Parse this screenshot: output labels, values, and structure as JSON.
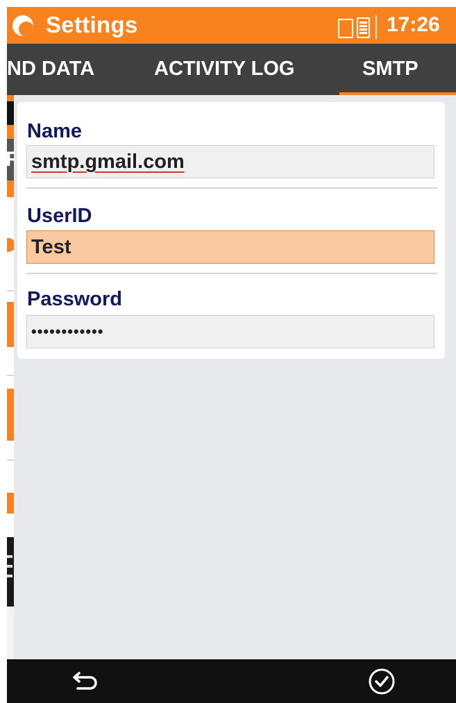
{
  "status_bar": {
    "title": "Settings",
    "time": "17:26",
    "icons": [
      "app-logo-icon",
      "phone-icon",
      "battery-icon"
    ]
  },
  "tabs": [
    {
      "label": "ND DATA",
      "selected": false
    },
    {
      "label": "ACTIVITY LOG",
      "selected": false
    },
    {
      "label": "SMTP",
      "selected": true
    }
  ],
  "background_app": {
    "letter": "R"
  },
  "form": {
    "name": {
      "label": "Name",
      "value": "smtp.gmail.com"
    },
    "userid": {
      "label": "UserID",
      "value": "Test"
    },
    "password": {
      "label": "Password",
      "value": "••••••••••••"
    }
  },
  "navbar": {
    "icons": [
      "back-icon",
      "check-icon"
    ]
  },
  "colors": {
    "accent": "#f7821e",
    "tab_bg": "#404040",
    "label": "#101a5c",
    "active_field": "#fac9a2"
  }
}
